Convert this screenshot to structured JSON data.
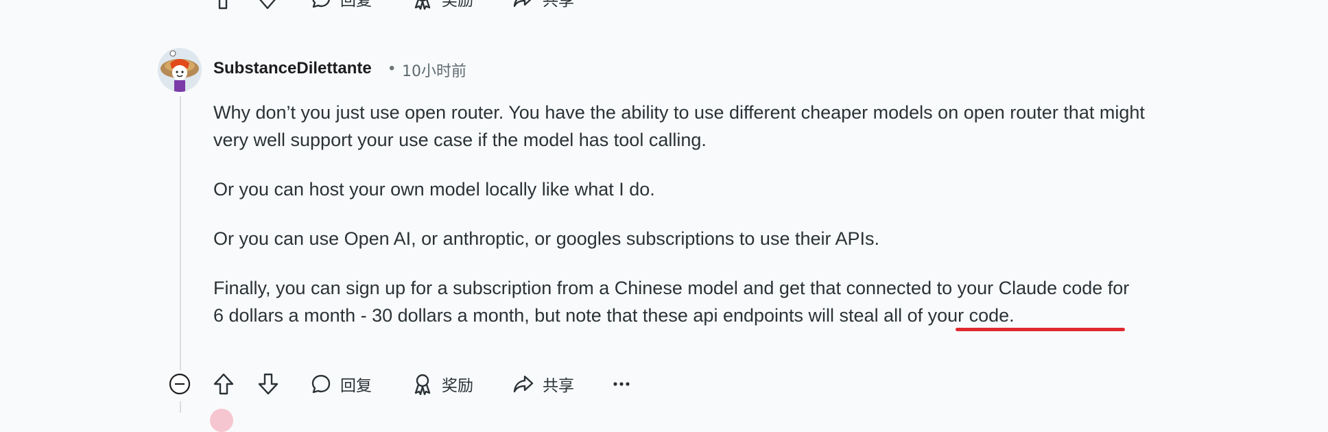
{
  "top_actions": {
    "reply_label": "回复",
    "award_label": "奖励",
    "share_label": "共享"
  },
  "comment": {
    "author": "SubstanceDilettante",
    "separator": "•",
    "time": "10小时前",
    "paragraphs": [
      "Why don’t you just use open router. You have the ability to use different cheaper models on open router that might very well support your use case if the model has tool calling.",
      "Or you can host your own model locally like what I do.",
      "Or you can use Open AI, or anthroptic, or googles subscriptions to use their APIs.",
      "Finally, you can sign up for a subscription from a Chinese model and get that connected to your Claude code for 6 dollars a month - 30 dollars a month, but note that these api endpoints will steal all of your code."
    ],
    "annotation": {
      "type": "red-underline",
      "text": "will steal all of your",
      "color": "#e0282e"
    }
  },
  "actions": {
    "reply_label": "回复",
    "award_label": "奖励",
    "share_label": "共享",
    "more_label": "···"
  },
  "icons": [
    "collapse-icon",
    "upvote-icon",
    "downvote-icon",
    "comment-icon",
    "award-icon",
    "share-icon",
    "more-icon"
  ]
}
